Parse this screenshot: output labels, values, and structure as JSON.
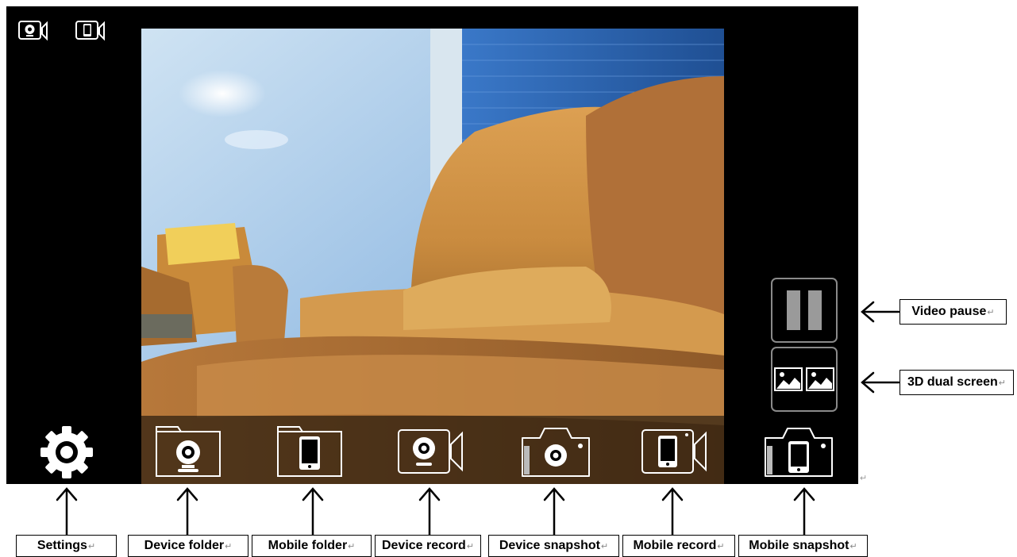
{
  "labels": {
    "settings": "Settings",
    "device_folder": "Device folder",
    "mobile_folder": "Mobile folder",
    "device_record": "Device record",
    "device_snapshot": "Device snapshot",
    "mobile_record": "Mobile record",
    "mobile_snapshot": "Mobile snapshot",
    "video_pause": "Video pause",
    "dual_screen": "3D dual screen"
  },
  "icons": {
    "top_left": "device-camera-switch-icon",
    "top_second": "mobile-camera-switch-icon",
    "settings": "gear-icon",
    "device_folder": "device-folder-icon",
    "mobile_folder": "mobile-folder-icon",
    "device_record": "device-record-icon",
    "device_snapshot": "device-snapshot-icon",
    "mobile_record": "mobile-record-icon",
    "mobile_snapshot": "mobile-snapshot-icon",
    "pause": "pause-icon",
    "dual_screen": "dual-screen-icon"
  },
  "return_mark": "↵",
  "colors": {
    "app_background": "#000000",
    "icon_stroke": "#ffffff",
    "button_border": "#8a8a8a",
    "label_border": "#000000"
  }
}
